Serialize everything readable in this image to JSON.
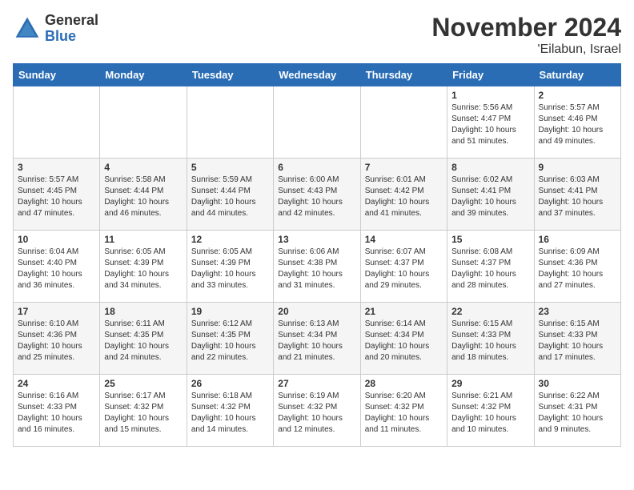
{
  "logo": {
    "general": "General",
    "blue": "Blue"
  },
  "header": {
    "month": "November 2024",
    "location": "'Eilabun, Israel"
  },
  "weekdays": [
    "Sunday",
    "Monday",
    "Tuesday",
    "Wednesday",
    "Thursday",
    "Friday",
    "Saturday"
  ],
  "weeks": [
    [
      {
        "day": "",
        "info": ""
      },
      {
        "day": "",
        "info": ""
      },
      {
        "day": "",
        "info": ""
      },
      {
        "day": "",
        "info": ""
      },
      {
        "day": "",
        "info": ""
      },
      {
        "day": "1",
        "info": "Sunrise: 5:56 AM\nSunset: 4:47 PM\nDaylight: 10 hours\nand 51 minutes."
      },
      {
        "day": "2",
        "info": "Sunrise: 5:57 AM\nSunset: 4:46 PM\nDaylight: 10 hours\nand 49 minutes."
      }
    ],
    [
      {
        "day": "3",
        "info": "Sunrise: 5:57 AM\nSunset: 4:45 PM\nDaylight: 10 hours\nand 47 minutes."
      },
      {
        "day": "4",
        "info": "Sunrise: 5:58 AM\nSunset: 4:44 PM\nDaylight: 10 hours\nand 46 minutes."
      },
      {
        "day": "5",
        "info": "Sunrise: 5:59 AM\nSunset: 4:44 PM\nDaylight: 10 hours\nand 44 minutes."
      },
      {
        "day": "6",
        "info": "Sunrise: 6:00 AM\nSunset: 4:43 PM\nDaylight: 10 hours\nand 42 minutes."
      },
      {
        "day": "7",
        "info": "Sunrise: 6:01 AM\nSunset: 4:42 PM\nDaylight: 10 hours\nand 41 minutes."
      },
      {
        "day": "8",
        "info": "Sunrise: 6:02 AM\nSunset: 4:41 PM\nDaylight: 10 hours\nand 39 minutes."
      },
      {
        "day": "9",
        "info": "Sunrise: 6:03 AM\nSunset: 4:41 PM\nDaylight: 10 hours\nand 37 minutes."
      }
    ],
    [
      {
        "day": "10",
        "info": "Sunrise: 6:04 AM\nSunset: 4:40 PM\nDaylight: 10 hours\nand 36 minutes."
      },
      {
        "day": "11",
        "info": "Sunrise: 6:05 AM\nSunset: 4:39 PM\nDaylight: 10 hours\nand 34 minutes."
      },
      {
        "day": "12",
        "info": "Sunrise: 6:05 AM\nSunset: 4:39 PM\nDaylight: 10 hours\nand 33 minutes."
      },
      {
        "day": "13",
        "info": "Sunrise: 6:06 AM\nSunset: 4:38 PM\nDaylight: 10 hours\nand 31 minutes."
      },
      {
        "day": "14",
        "info": "Sunrise: 6:07 AM\nSunset: 4:37 PM\nDaylight: 10 hours\nand 29 minutes."
      },
      {
        "day": "15",
        "info": "Sunrise: 6:08 AM\nSunset: 4:37 PM\nDaylight: 10 hours\nand 28 minutes."
      },
      {
        "day": "16",
        "info": "Sunrise: 6:09 AM\nSunset: 4:36 PM\nDaylight: 10 hours\nand 27 minutes."
      }
    ],
    [
      {
        "day": "17",
        "info": "Sunrise: 6:10 AM\nSunset: 4:36 PM\nDaylight: 10 hours\nand 25 minutes."
      },
      {
        "day": "18",
        "info": "Sunrise: 6:11 AM\nSunset: 4:35 PM\nDaylight: 10 hours\nand 24 minutes."
      },
      {
        "day": "19",
        "info": "Sunrise: 6:12 AM\nSunset: 4:35 PM\nDaylight: 10 hours\nand 22 minutes."
      },
      {
        "day": "20",
        "info": "Sunrise: 6:13 AM\nSunset: 4:34 PM\nDaylight: 10 hours\nand 21 minutes."
      },
      {
        "day": "21",
        "info": "Sunrise: 6:14 AM\nSunset: 4:34 PM\nDaylight: 10 hours\nand 20 minutes."
      },
      {
        "day": "22",
        "info": "Sunrise: 6:15 AM\nSunset: 4:33 PM\nDaylight: 10 hours\nand 18 minutes."
      },
      {
        "day": "23",
        "info": "Sunrise: 6:15 AM\nSunset: 4:33 PM\nDaylight: 10 hours\nand 17 minutes."
      }
    ],
    [
      {
        "day": "24",
        "info": "Sunrise: 6:16 AM\nSunset: 4:33 PM\nDaylight: 10 hours\nand 16 minutes."
      },
      {
        "day": "25",
        "info": "Sunrise: 6:17 AM\nSunset: 4:32 PM\nDaylight: 10 hours\nand 15 minutes."
      },
      {
        "day": "26",
        "info": "Sunrise: 6:18 AM\nSunset: 4:32 PM\nDaylight: 10 hours\nand 14 minutes."
      },
      {
        "day": "27",
        "info": "Sunrise: 6:19 AM\nSunset: 4:32 PM\nDaylight: 10 hours\nand 12 minutes."
      },
      {
        "day": "28",
        "info": "Sunrise: 6:20 AM\nSunset: 4:32 PM\nDaylight: 10 hours\nand 11 minutes."
      },
      {
        "day": "29",
        "info": "Sunrise: 6:21 AM\nSunset: 4:32 PM\nDaylight: 10 hours\nand 10 minutes."
      },
      {
        "day": "30",
        "info": "Sunrise: 6:22 AM\nSunset: 4:31 PM\nDaylight: 10 hours\nand 9 minutes."
      }
    ]
  ]
}
